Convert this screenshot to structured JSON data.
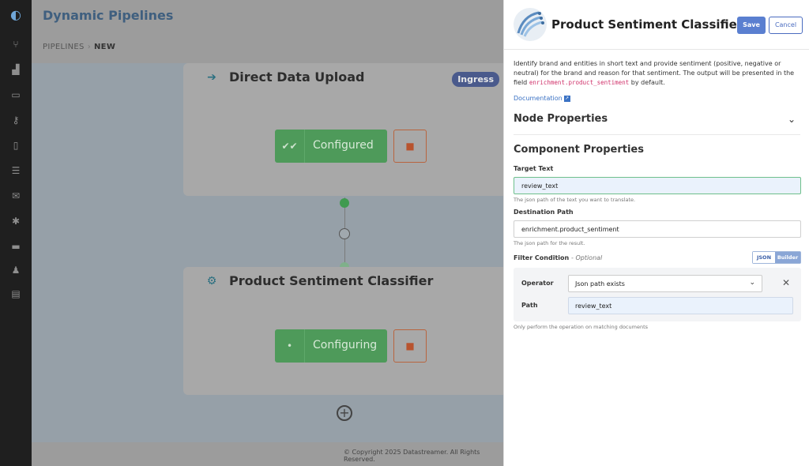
{
  "app": {
    "title": "Dynamic Pipelines",
    "breadcrumb": [
      "PIPELINES",
      "NEW"
    ],
    "footer": "© Copyright 2025 Datastreamer. All Rights Reserved."
  },
  "sidebar_icons": [
    "logo-icon",
    "branch-icon",
    "chart-icon",
    "archive-icon",
    "key-icon",
    "book-icon",
    "list-icon",
    "mail-icon",
    "puzzle-icon",
    "card-icon",
    "bell-icon",
    "calculator-icon"
  ],
  "nodes": [
    {
      "title": "Direct Data Upload",
      "badge": "Ingress",
      "status": "Configured",
      "icon": "ingress-arrow-icon"
    },
    {
      "title": "Product Sentiment Classifier",
      "status": "Configuring",
      "icon": "classifier-icon"
    }
  ],
  "panel": {
    "title": "Product Sentiment Classifier",
    "save": "Save",
    "cancel": "Cancel",
    "description_1": "Identify brand and entities in short text and provide sentiment (positive, negative or neutral) for the brand and reason for that sentiment. The output will be presented in the field",
    "description_code": "enrichment.product_sentiment",
    "description_2": "by default.",
    "doc_link": "Documentation",
    "node_properties": "Node Properties",
    "component_properties": "Component Properties",
    "target_text": {
      "label": "Target Text",
      "value": "review_text",
      "help": "The json path of the text you want to translate."
    },
    "destination_path": {
      "label": "Destination Path",
      "value": "enrichment.product_sentiment",
      "help": "The json path for the result."
    },
    "filter": {
      "label": "Filter Condition",
      "optional": "- Optional",
      "toggle_json": "JSON",
      "toggle_builder": "Builder",
      "operator_label": "Operator",
      "operator_value": "Json path exists",
      "path_label": "Path",
      "path_value": "review_text",
      "help": "Only perform the operation on matching documents"
    }
  },
  "colors": {
    "accent": "#5a7fd0",
    "success": "#4e9a5a",
    "danger": "#b8532e",
    "code": "#d0316a"
  }
}
